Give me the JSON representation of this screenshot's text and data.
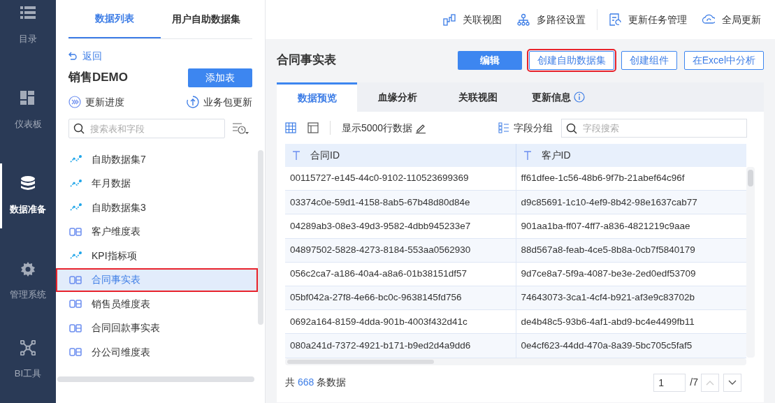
{
  "nav": [
    {
      "label": "目录",
      "selected": false
    },
    {
      "label": "仪表板",
      "selected": false
    },
    {
      "label": "数据准备",
      "selected": true
    },
    {
      "label": "管理系统",
      "selected": false
    },
    {
      "label": "BI工具",
      "selected": false
    }
  ],
  "sidebar": {
    "tabs": [
      {
        "label": "数据列表",
        "selected": true
      },
      {
        "label": "用户自助数据集",
        "selected": false
      }
    ],
    "back": "返回",
    "package_title": "销售DEMO",
    "add_button": "添加表",
    "update_progress": "更新进度",
    "package_update": "业务包更新",
    "search": {
      "placeholder": "搜索表和字段"
    },
    "items": [
      {
        "label": "自助数据集7",
        "kind": "dataset",
        "selected": false,
        "highlighted": false
      },
      {
        "label": "年月数据",
        "kind": "dataset",
        "selected": false,
        "highlighted": false
      },
      {
        "label": "自助数据集3",
        "kind": "dataset",
        "selected": false,
        "highlighted": false
      },
      {
        "label": "客户维度表",
        "kind": "table",
        "selected": false,
        "highlighted": false
      },
      {
        "label": "KPI指标项",
        "kind": "dataset",
        "selected": false,
        "highlighted": false
      },
      {
        "label": "合同事实表",
        "kind": "table",
        "selected": true,
        "highlighted": true
      },
      {
        "label": "销售员维度表",
        "kind": "table",
        "selected": false,
        "highlighted": false
      },
      {
        "label": "合同回款事实表",
        "kind": "table",
        "selected": false,
        "highlighted": false
      },
      {
        "label": "分公司维度表",
        "kind": "table",
        "selected": false,
        "highlighted": false
      }
    ]
  },
  "toolbar": [
    {
      "label": "关联视图"
    },
    {
      "label": "多路径设置"
    },
    {
      "label": "更新任务管理"
    },
    {
      "label": "全局更新"
    }
  ],
  "table_title": "合同事实表",
  "actions": [
    {
      "label": "编辑",
      "kind": "primary",
      "highlighted": false
    },
    {
      "label": "创建自助数据集",
      "kind": "outline",
      "highlighted": true
    },
    {
      "label": "创建组件",
      "kind": "outline",
      "highlighted": false
    },
    {
      "label": "在Excel中分析",
      "kind": "outline",
      "highlighted": false
    }
  ],
  "tabs": [
    {
      "label": "数据预览",
      "selected": true,
      "info": false
    },
    {
      "label": "血缘分析",
      "selected": false,
      "info": false
    },
    {
      "label": "关联视图",
      "selected": false,
      "info": false
    },
    {
      "label": "更新信息",
      "selected": false,
      "info": true
    }
  ],
  "preview": {
    "rows_setting": "显示5000行数据",
    "group_button": "字段分组",
    "field_search": {
      "placeholder": "字段搜索"
    },
    "columns": [
      {
        "name": "合同ID"
      },
      {
        "name": "客户ID"
      }
    ],
    "rows": [
      [
        "00115727-e145-44c0-9102-110523699369",
        "ff61dfee-1c56-48b6-9f7b-21abef64c96f"
      ],
      [
        "03374c0e-59d1-4158-8ab5-67b48d80d84e",
        "d9c85691-1c10-4ef9-8b42-98e1637cab77"
      ],
      [
        "04289ab3-08e3-49d3-9582-4dbb945233e7",
        "901aa1ba-ff07-4ff7-a836-4821219c9aae"
      ],
      [
        "04897502-5828-4273-8184-553aa0562930",
        "88d567a8-feab-4ce5-8b8a-0cb7f5840179"
      ],
      [
        "056c2ca7-a186-40a4-a8a6-01b38151df57",
        "9d7ce8a7-5f9a-4087-be3e-2ed0edf53709"
      ],
      [
        "05bf042a-27f8-4e66-bc0c-9638145fd756",
        "74643073-3ca1-4cf4-b921-af3e9c83702b"
      ],
      [
        "0692a164-8159-4dda-901b-4003f432d41c",
        "de4b48c5-93b6-4af1-abd9-bc4e4499fb11"
      ],
      [
        "080a241d-7372-4921-b171-b9ed2d4a9dd6",
        "0e4cf623-44dd-470a-8a39-5bc705c5faf5"
      ]
    ]
  },
  "footer": {
    "prefix": "共",
    "count": "668",
    "suffix": "条数据",
    "page": "1",
    "page_total": "/7"
  }
}
